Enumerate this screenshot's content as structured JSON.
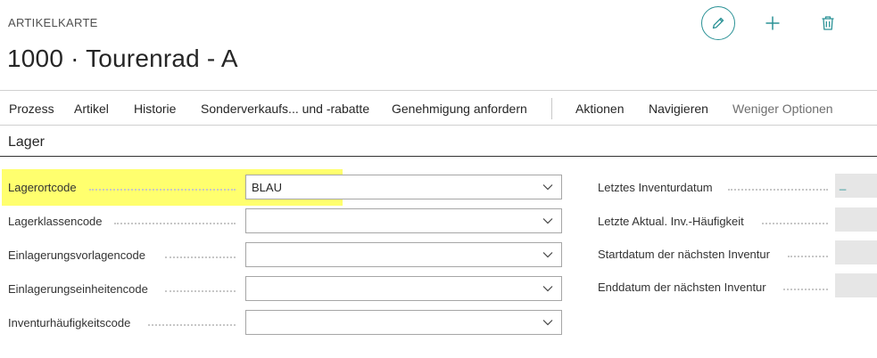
{
  "page": {
    "caption": "ARTIKELKARTE",
    "title": "1000 · Tourenrad - A"
  },
  "header_actions": {
    "edit_icon": "pencil-icon",
    "new_icon": "plus-icon",
    "delete_icon": "trash-icon",
    "accent_color": "#2b9296"
  },
  "actionbar": {
    "items": [
      "Prozess",
      "Artikel",
      "Historie",
      "Sonderverkaufs... und -rabatte",
      "Genehmigung anfordern",
      "Aktionen",
      "Navigieren",
      "Weniger Optionen"
    ]
  },
  "section": {
    "title": "Lager"
  },
  "left_fields": [
    {
      "label": "Lagerortcode",
      "value": "BLAU",
      "highlighted": true
    },
    {
      "label": "Lagerklassencode",
      "value": ""
    },
    {
      "label": "Einlagerungsvorlagencode",
      "value": ""
    },
    {
      "label": "Einlagerungseinheitencode",
      "value": ""
    },
    {
      "label": "Inventurhäufigkeitscode",
      "value": ""
    }
  ],
  "right_fields": [
    {
      "label": "Letztes Inventurdatum",
      "value": "_"
    },
    {
      "label": "Letzte Aktual. Inv.-Häufigkeit",
      "value": ""
    },
    {
      "label": "Startdatum der nächsten Inventur",
      "value": ""
    },
    {
      "label": "Enddatum der nächsten Inventur",
      "value": ""
    }
  ],
  "highlight_color": "#ffff6e"
}
